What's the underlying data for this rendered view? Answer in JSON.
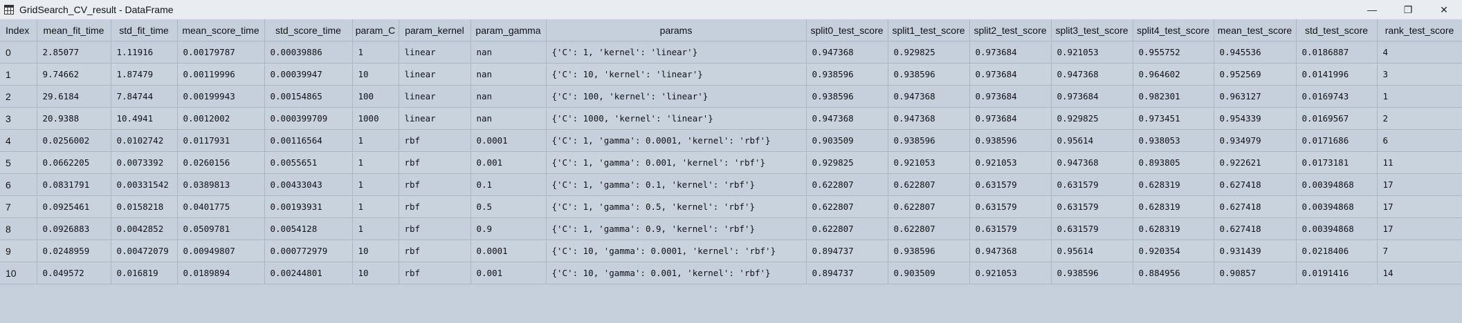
{
  "window": {
    "title": "GridSearch_CV_result - DataFrame",
    "minimize_glyph": "—",
    "restore_glyph": "❐",
    "close_glyph": "✕"
  },
  "table": {
    "columns": [
      "Index",
      "mean_fit_time",
      "std_fit_time",
      "mean_score_time",
      "std_score_time",
      "param_C",
      "param_kernel",
      "param_gamma",
      "params",
      "split0_test_score",
      "split1_test_score",
      "split2_test_score",
      "split3_test_score",
      "split4_test_score",
      "mean_test_score",
      "std_test_score",
      "rank_test_score"
    ],
    "rows": [
      [
        "0",
        "2.85077",
        "1.11916",
        "0.00179787",
        "0.00039886",
        "1",
        "linear",
        "nan",
        "{'C': 1, 'kernel': 'linear'}",
        "0.947368",
        "0.929825",
        "0.973684",
        "0.921053",
        "0.955752",
        "0.945536",
        "0.0186887",
        "4"
      ],
      [
        "1",
        "9.74662",
        "1.87479",
        "0.00119996",
        "0.00039947",
        "10",
        "linear",
        "nan",
        "{'C': 10, 'kernel': 'linear'}",
        "0.938596",
        "0.938596",
        "0.973684",
        "0.947368",
        "0.964602",
        "0.952569",
        "0.0141996",
        "3"
      ],
      [
        "2",
        "29.6184",
        "7.84744",
        "0.00199943",
        "0.00154865",
        "100",
        "linear",
        "nan",
        "{'C': 100, 'kernel': 'linear'}",
        "0.938596",
        "0.947368",
        "0.973684",
        "0.973684",
        "0.982301",
        "0.963127",
        "0.0169743",
        "1"
      ],
      [
        "3",
        "20.9388",
        "10.4941",
        "0.0012002",
        "0.000399709",
        "1000",
        "linear",
        "nan",
        "{'C': 1000, 'kernel': 'linear'}",
        "0.947368",
        "0.947368",
        "0.973684",
        "0.929825",
        "0.973451",
        "0.954339",
        "0.0169567",
        "2"
      ],
      [
        "4",
        "0.0256002",
        "0.0102742",
        "0.0117931",
        "0.00116564",
        "1",
        "rbf",
        "0.0001",
        "{'C': 1, 'gamma': 0.0001, 'kernel': 'rbf'}",
        "0.903509",
        "0.938596",
        "0.938596",
        "0.95614",
        "0.938053",
        "0.934979",
        "0.0171686",
        "6"
      ],
      [
        "5",
        "0.0662205",
        "0.0073392",
        "0.0260156",
        "0.0055651",
        "1",
        "rbf",
        "0.001",
        "{'C': 1, 'gamma': 0.001, 'kernel': 'rbf'}",
        "0.929825",
        "0.921053",
        "0.921053",
        "0.947368",
        "0.893805",
        "0.922621",
        "0.0173181",
        "11"
      ],
      [
        "6",
        "0.0831791",
        "0.00331542",
        "0.0389813",
        "0.00433043",
        "1",
        "rbf",
        "0.1",
        "{'C': 1, 'gamma': 0.1, 'kernel': 'rbf'}",
        "0.622807",
        "0.622807",
        "0.631579",
        "0.631579",
        "0.628319",
        "0.627418",
        "0.00394868",
        "17"
      ],
      [
        "7",
        "0.0925461",
        "0.0158218",
        "0.0401775",
        "0.00193931",
        "1",
        "rbf",
        "0.5",
        "{'C': 1, 'gamma': 0.5, 'kernel': 'rbf'}",
        "0.622807",
        "0.622807",
        "0.631579",
        "0.631579",
        "0.628319",
        "0.627418",
        "0.00394868",
        "17"
      ],
      [
        "8",
        "0.0926883",
        "0.0042852",
        "0.0509781",
        "0.0054128",
        "1",
        "rbf",
        "0.9",
        "{'C': 1, 'gamma': 0.9, 'kernel': 'rbf'}",
        "0.622807",
        "0.622807",
        "0.631579",
        "0.631579",
        "0.628319",
        "0.627418",
        "0.00394868",
        "17"
      ],
      [
        "9",
        "0.0248959",
        "0.00472079",
        "0.00949807",
        "0.000772979",
        "10",
        "rbf",
        "0.0001",
        "{'C': 10, 'gamma': 0.0001, 'kernel': 'rbf'}",
        "0.894737",
        "0.938596",
        "0.947368",
        "0.95614",
        "0.920354",
        "0.931439",
        "0.0218406",
        "7"
      ],
      [
        "10",
        "0.049572",
        "0.016819",
        "0.0189894",
        "0.00244801",
        "10",
        "rbf",
        "0.001",
        "{'C': 10, 'gamma': 0.001, 'kernel': 'rbf'}",
        "0.894737",
        "0.903509",
        "0.921053",
        "0.938596",
        "0.884956",
        "0.90857",
        "0.0191416",
        "14"
      ]
    ]
  }
}
